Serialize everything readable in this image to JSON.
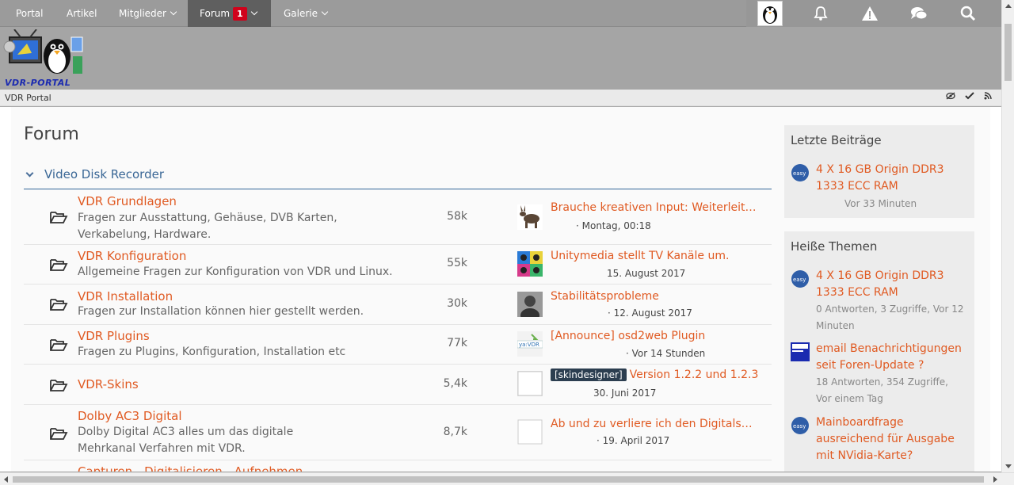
{
  "nav": {
    "items": [
      {
        "label": "Portal"
      },
      {
        "label": "Artikel"
      },
      {
        "label": "Mitglieder"
      },
      {
        "label": "Forum",
        "badge": "1"
      },
      {
        "label": "Galerie"
      }
    ],
    "icons": [
      "user-avatar",
      "bell-icon",
      "warning-icon",
      "chat-icon",
      "search-icon"
    ]
  },
  "header": {
    "logo_text": "VDR-PORTAL"
  },
  "breadcrumb": {
    "text": "VDR Portal"
  },
  "page": {
    "title": "Forum"
  },
  "category": {
    "title": "Video Disk Recorder"
  },
  "boards": [
    {
      "title": "VDR Grundlagen",
      "desc": "Fragen zur Ausstattung, Gehäuse, DVB Karten, Verkabelung, Hardware.",
      "count": "58k",
      "last_title": "Brauche kreativen Input: Weiterleitung…",
      "last_meta": "· Montag, 00:18"
    },
    {
      "title": "VDR Konfiguration",
      "desc": "Allgemeine Fragen zur Konfiguration von VDR und Linux.",
      "count": "55k",
      "last_title": "Unitymedia stellt TV Kanäle um.",
      "last_meta": "15. August 2017"
    },
    {
      "title": "VDR Installation",
      "desc": "Fragen zur Installation können hier gestellt werden.",
      "count": "30k",
      "last_title": "Stabilitätsprobleme",
      "last_meta": "· 12. August 2017"
    },
    {
      "title": "VDR Plugins",
      "desc": "Fragen zu Plugins, Konfiguration, Installation etc",
      "count": "77k",
      "last_title": "[Announce] osd2web Plugin",
      "last_meta": "· Vor 14 Stunden"
    },
    {
      "title": "VDR-Skins",
      "desc": "",
      "count": "5,4k",
      "last_tag": "[skindesigner]",
      "last_title": "Version 1.2.2 und 1.2.3",
      "last_meta": "30. Juni 2017"
    },
    {
      "title": "Dolby AC3 Digital",
      "desc": "Dolby Digital AC3 alles um das digitale Mehrkanal Verfahren mit VDR.",
      "count": "8,7k",
      "last_title": "Ab und zu verliere ich den Digitalsound…",
      "last_meta": "· 19. April 2017"
    },
    {
      "title": "Capturen - Digitalisieren - Aufnehmen"
    }
  ],
  "sidebar": {
    "latest": {
      "title": "Letzte Beiträge",
      "entries": [
        {
          "title": "4 X 16 GB Origin DDR3 1333 ECC RAM",
          "meta": "Vor 33 Minuten"
        }
      ]
    },
    "hot": {
      "title": "Heiße Themen",
      "entries": [
        {
          "title": "4 X 16 GB Origin DDR3 1333 ECC RAM",
          "meta": "0 Antworten, 3 Zugriffe, Vor 12 Minuten"
        },
        {
          "title": "email Benachrichtigungen seit Foren-Update ?",
          "meta": "18 Antworten, 354 Zugriffe, Vor einem Tag"
        },
        {
          "title": "Mainboardfrage ausreichend für Ausgabe mit NVidia-Karte?"
        }
      ]
    }
  },
  "colors": {
    "accent": "#e05a22",
    "link_blue": "#3a6796",
    "nav_bg": "#9b9b9b",
    "badge": "#d0021b"
  }
}
